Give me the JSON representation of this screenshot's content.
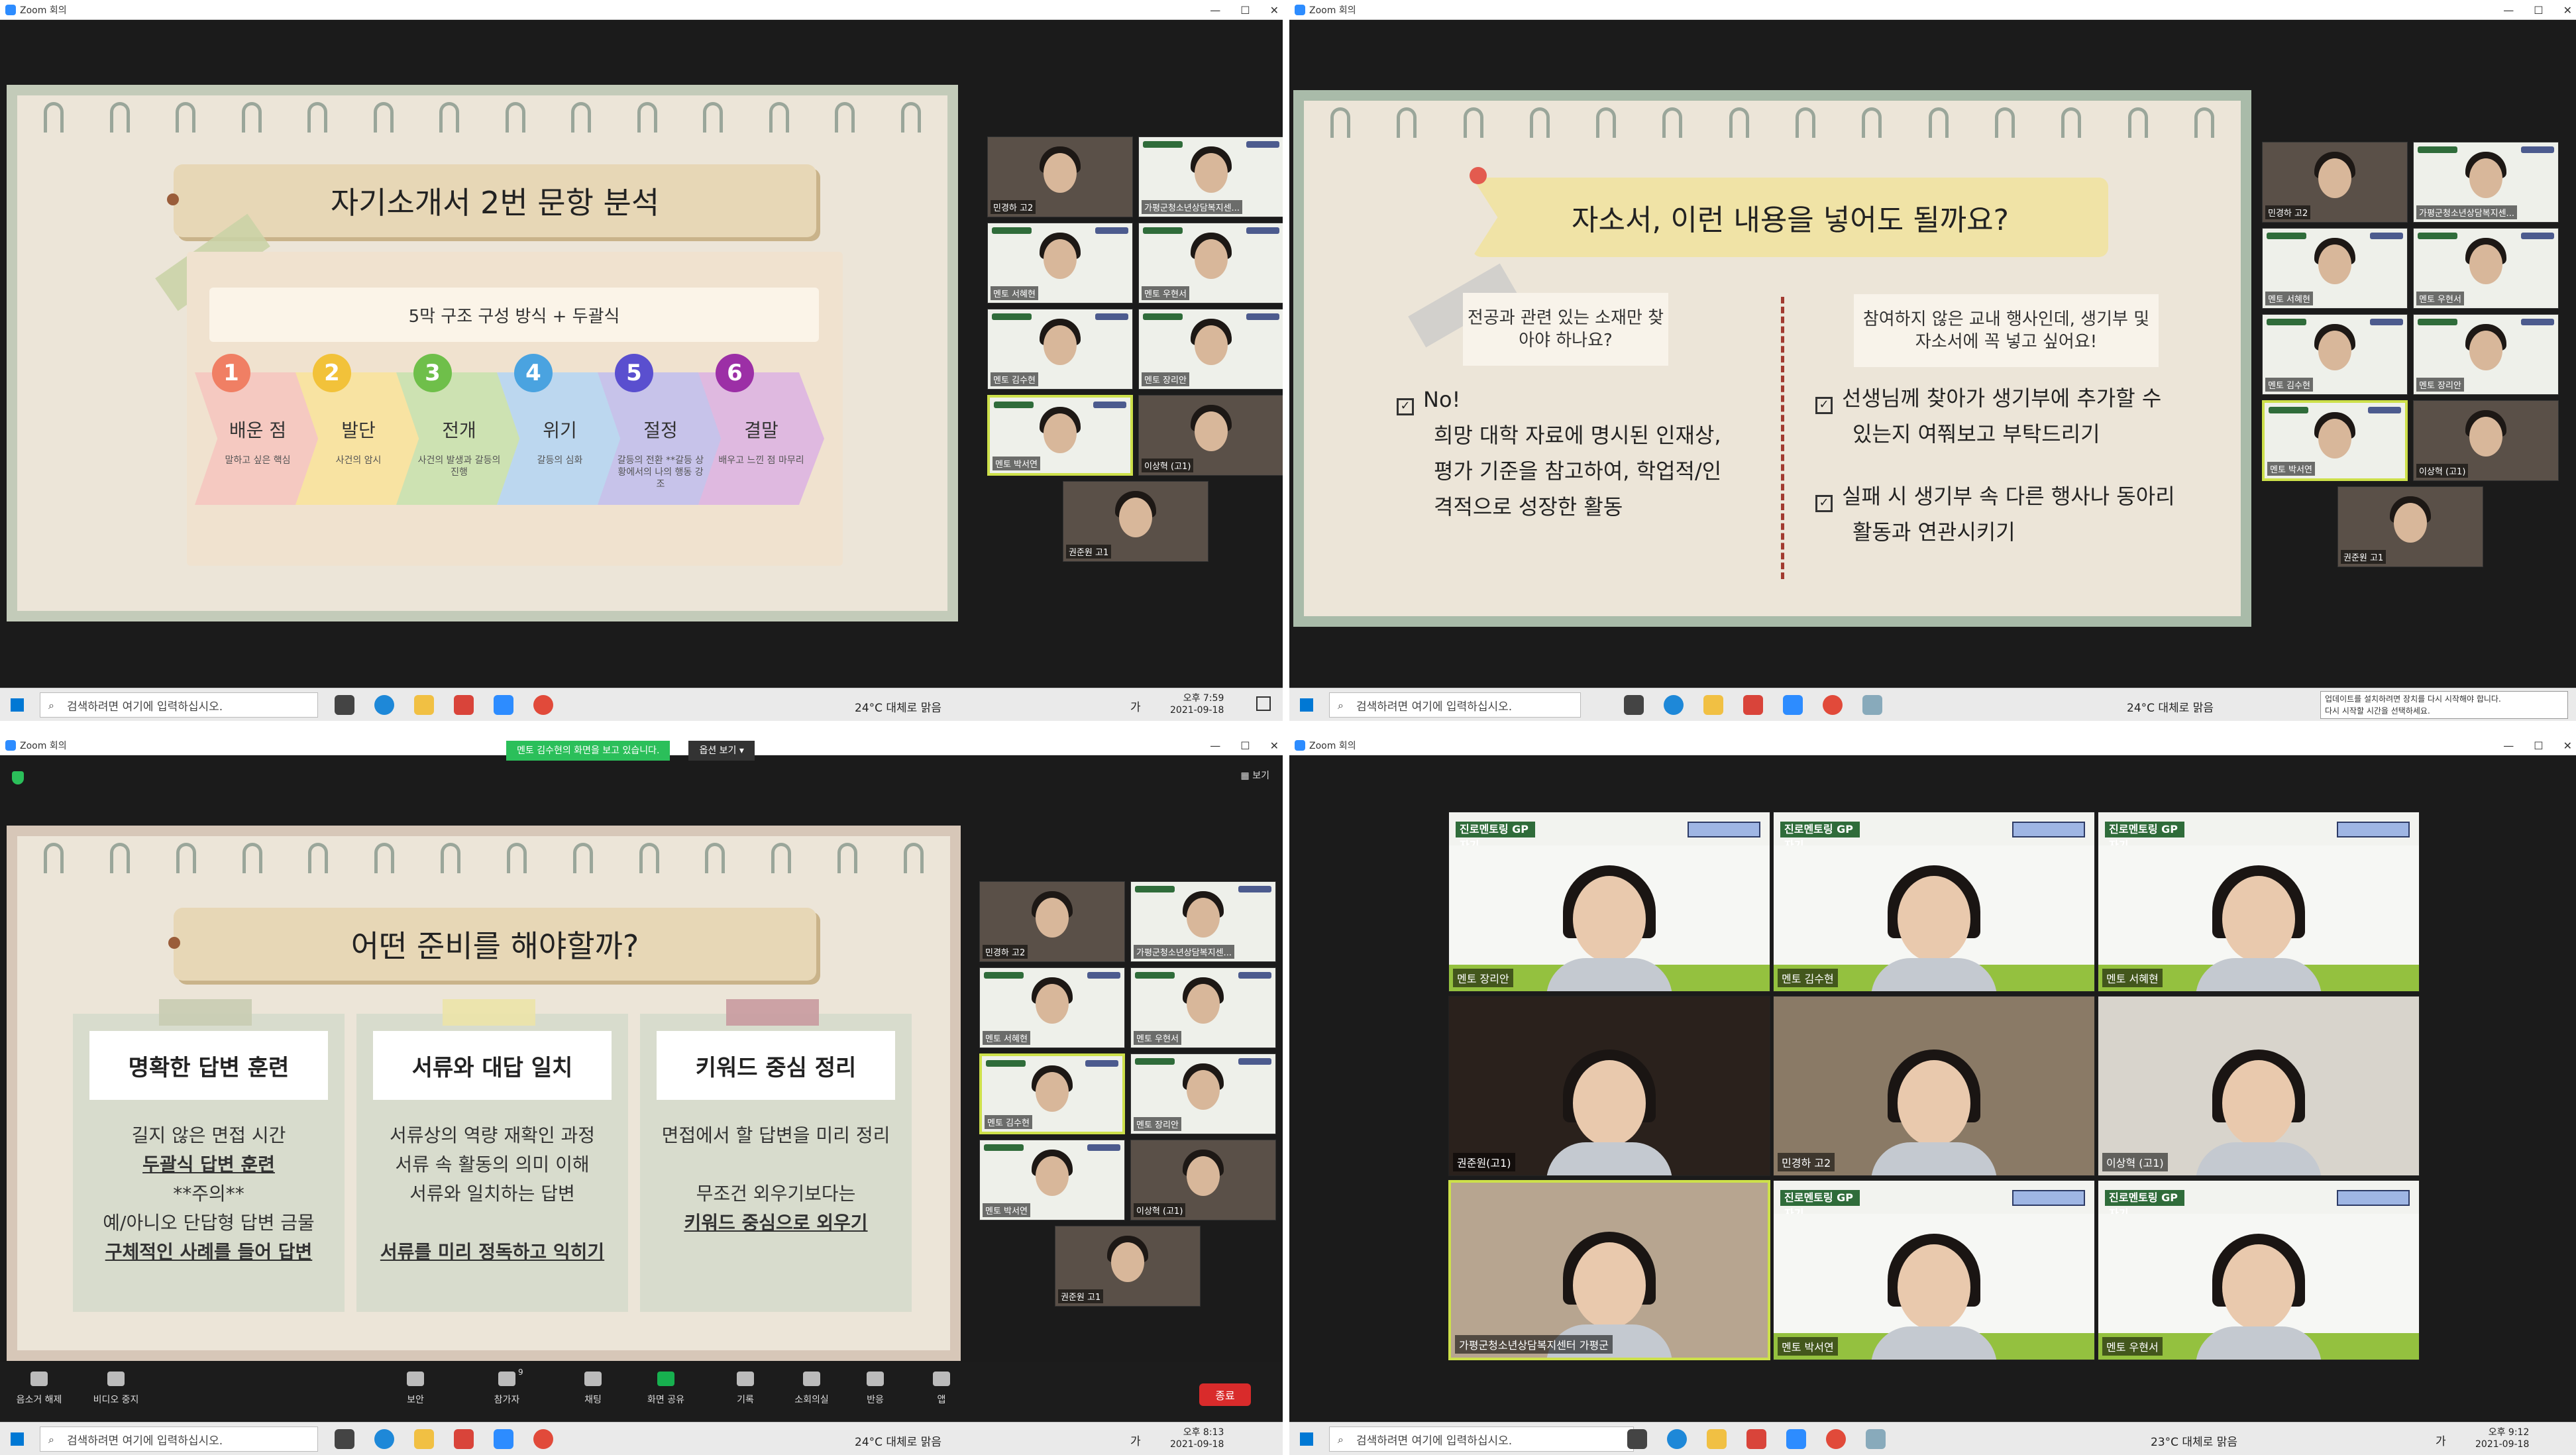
{
  "window_title": "Zoom 회의",
  "taskbar": {
    "search_placeholder": "검색하려면 여기에 입력하십시오.",
    "weather_q1": "24°C 대체로 맑음",
    "weather_q2": "24°C 대체로 맑음",
    "weather_q3": "24°C 대체로 맑음",
    "weather_q4": "23°C 대체로 맑음",
    "time_q1": "오후 7:59",
    "date_q1": "2021-09-18",
    "time_q3": "오후 8:13",
    "date_q3": "2021-09-18",
    "time_q4": "오후 9:12",
    "date_q4": "2021-09-18",
    "update_notice_1": "업데이트를 설치하려면 장치를 다시 시작해야 합니다.",
    "update_notice_2": "다시 시작할 시간을 선택하세요.",
    "lang": "가"
  },
  "slide1": {
    "title": "자기소개서  2번 문항 분석",
    "subtitle": "5막 구조 구성 방식 + 두괄식",
    "steps": [
      {
        "num": "1",
        "title": "배운 점",
        "desc": "말하고 싶은 핵심",
        "color": "#f07f64",
        "bg": "#f5c9c1"
      },
      {
        "num": "2",
        "title": "발단",
        "desc": "사건의 암시",
        "color": "#f2c23a",
        "bg": "#f8e3a2"
      },
      {
        "num": "3",
        "title": "전개",
        "desc": "사건의 발생과 갈등의 진행",
        "color": "#6fbf4a",
        "bg": "#cde2b2"
      },
      {
        "num": "4",
        "title": "위기",
        "desc": "갈등의 심화",
        "color": "#4aa3e0",
        "bg": "#bcd7ef"
      },
      {
        "num": "5",
        "title": "절정",
        "desc": "갈등의 전환 **갈등 상황에서의 나의 행동 강조",
        "color": "#5a4fcf",
        "bg": "#c7c3ea"
      },
      {
        "num": "6",
        "title": "결말",
        "desc": "배우고 느낀 점 마무리",
        "color": "#9c2fa6",
        "bg": "#dfb9e0"
      }
    ]
  },
  "slide2": {
    "title": "자소서, 이런 내용을 넣어도 될까요?",
    "left_card": "전공과 관련 있는 소재만 찾아야 하나요?",
    "left_line1": "No!",
    "left_line2": "희망 대학 자료에 명시된 인재상,",
    "left_line3": "평가 기준을 참고하여, 학업적/인",
    "left_line4": "격적으로 성장한 활동",
    "right_card": "참여하지 않은 교내 행사인데, 생기부 및 자소서에 꼭 넣고 싶어요!",
    "right_item1a": "선생님께 찾아가 생기부에 추가할 수",
    "right_item1b": "있는지 여쭤보고 부탁드리기",
    "right_item2a": "실패 시 생기부 속 다른 행사나 동아리",
    "right_item2b": "활동과 연관시키기",
    "check": "✓"
  },
  "slide3": {
    "title": "어떤 준비를 해야할까?",
    "columns": [
      {
        "head": "명확한 답변 훈련",
        "l1": "길지 않은 면접 시간",
        "l2": "두괄식 답변 훈련",
        "l3": "**주의**",
        "l4": "예/아니오 단답형 답변 금물",
        "l5": "구체적인 사례를 들어 답변",
        "tape": "#c9ccb2"
      },
      {
        "head": "서류와 대답 일치",
        "l1": "서류상의 역량 재확인 과정",
        "l2": "서류 속 활동의 의미 이해",
        "l3": "서류와 일치하는 답변",
        "l4": "",
        "l5": "서류를 미리 정독하고 익히기",
        "tape": "#ece3a9"
      },
      {
        "head": "키워드 중심 정리",
        "l1": "면접에서 할 답변을 미리 정리",
        "l2": "",
        "l3": "무조건 외우기보다는",
        "l4": "키워드 중심으로 외우기",
        "l5": "",
        "tape": "#c99aa0"
      }
    ]
  },
  "zoom_share": {
    "viewing": "멘토 김수현의 화면을 보고 있습니다.",
    "options": "옵션 보기 ▾",
    "view": "보기"
  },
  "zoom_controls": [
    {
      "label": "음소거 해제"
    },
    {
      "label": "비디오 중지"
    },
    {
      "label": "보안"
    },
    {
      "label": "참가자"
    },
    {
      "label": "채팅"
    },
    {
      "label": "화면 공유"
    },
    {
      "label": "기록"
    },
    {
      "label": "소회의실"
    },
    {
      "label": "반응"
    },
    {
      "label": "앱"
    }
  ],
  "participant_count": "9",
  "end_label": "종료",
  "participants": {
    "p1": "민경하 고2",
    "p2": "가평군청소년상담복지센...",
    "p3": "멘토 서혜현",
    "p4": "멘토 우현서",
    "p5": "멘토 김수현",
    "p6": "멘토 장리안",
    "p7": "멘토 박서연",
    "p8": "이상혁 (고1)",
    "p9": "권준원 고1"
  },
  "gallery": {
    "banner_label": "진로멘토링 GP자기",
    "g1": "멘토 장리안",
    "g2": "멘토 김수현",
    "g3": "멘토 서혜현",
    "g4": "권준원(고1)",
    "g5": "민경하 고2",
    "g6": "이상혁 (고1)",
    "g7": "가평군청소년상담복지센터 가평군",
    "g8": "멘토 박서연",
    "g9": "멘토 우현서"
  }
}
